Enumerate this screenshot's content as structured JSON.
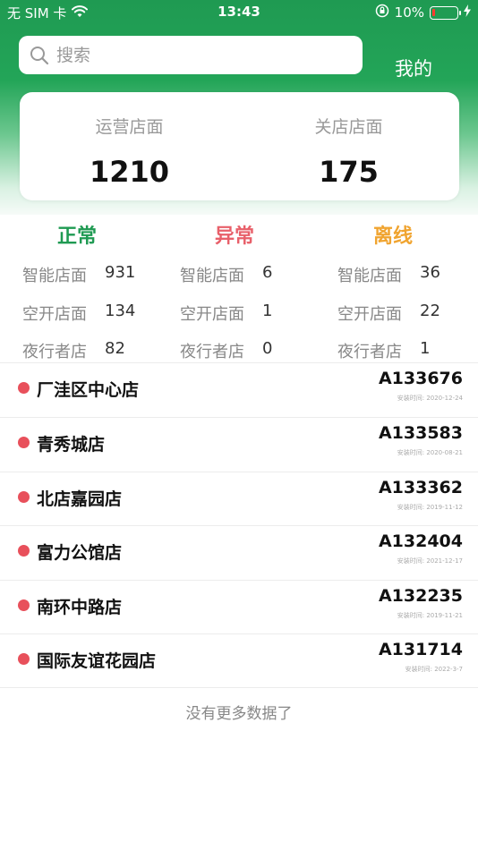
{
  "status_bar": {
    "carrier": "无 SIM 卡",
    "time": "13:43",
    "battery": "10%"
  },
  "search": {
    "placeholder": "搜索"
  },
  "header": {
    "mine_label": "我的"
  },
  "summary": {
    "operating_label": "运营店面",
    "operating_value": "1210",
    "closed_label": "关店店面",
    "closed_value": "175"
  },
  "status_groups": [
    {
      "title": "正常",
      "color": "#1f9a52",
      "rows": [
        {
          "label": "智能店面",
          "value": "931"
        },
        {
          "label": "空开店面",
          "value": "134"
        },
        {
          "label": "夜行者店",
          "value": "82"
        }
      ]
    },
    {
      "title": "异常",
      "color": "#e8606a",
      "rows": [
        {
          "label": "智能店面",
          "value": "6"
        },
        {
          "label": "空开店面",
          "value": "1"
        },
        {
          "label": "夜行者店",
          "value": "0"
        }
      ]
    },
    {
      "title": "离线",
      "color": "#f0a430",
      "rows": [
        {
          "label": "智能店面",
          "value": "36"
        },
        {
          "label": "空开店面",
          "value": "22"
        },
        {
          "label": "夜行者店",
          "value": "1"
        }
      ]
    }
  ],
  "stores": [
    {
      "name": "厂洼区中心店",
      "code": "A133676",
      "install": "安装时间: 2020-12-24"
    },
    {
      "name": "青秀城店",
      "code": "A133583",
      "install": "安装时间: 2020-08-21"
    },
    {
      "name": "北店嘉园店",
      "code": "A133362",
      "install": "安装时间: 2019-11-12"
    },
    {
      "name": "富力公馆店",
      "code": "A132404",
      "install": "安装时间: 2021-12-17"
    },
    {
      "name": "南环中路店",
      "code": "A132235",
      "install": "安装时间: 2019-11-21"
    },
    {
      "name": "国际友谊花园店",
      "code": "A131714",
      "install": "安装时间: 2022-3-7"
    }
  ],
  "footer": {
    "no_more": "没有更多数据了"
  },
  "colors": {
    "brand_green": "#1f9a52",
    "status_dot": "#e8505b"
  }
}
